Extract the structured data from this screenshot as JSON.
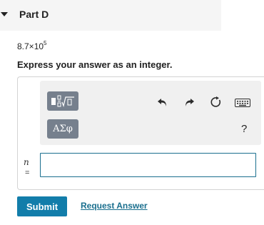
{
  "part": {
    "title": "Part D"
  },
  "question": {
    "mantissa": "8.7×10",
    "exponent": "5"
  },
  "instruction": "Express your answer as an integer.",
  "toolbar": {
    "greek_label": "ΑΣφ",
    "help_label": "?",
    "icons": [
      "templates-icon",
      "undo-icon",
      "redo-icon",
      "reset-icon",
      "keyboard-icon"
    ]
  },
  "answer": {
    "variable": "n",
    "equals": "=",
    "value": "",
    "placeholder": ""
  },
  "actions": {
    "submit_label": "Submit",
    "request_answer_label": "Request Answer"
  },
  "colors": {
    "submit": "#127daa",
    "link": "#1a6f8e",
    "toolbar_button": "#76808d",
    "toolbar_bg": "#f0f0f0"
  }
}
